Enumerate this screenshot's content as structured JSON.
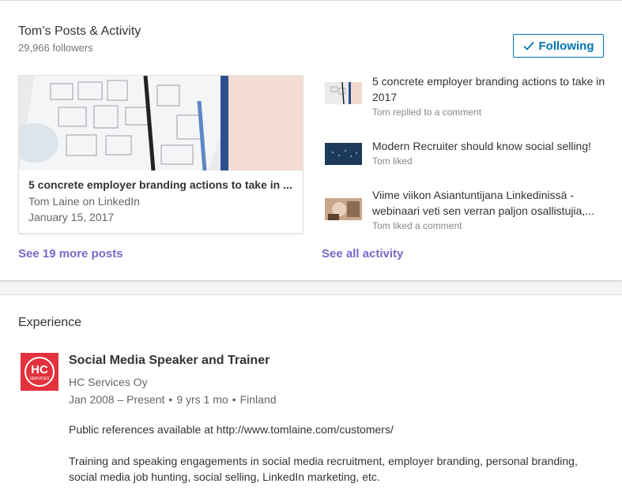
{
  "posts_section": {
    "title": "Tom’s Posts & Activity",
    "followers": "29,966 followers",
    "follow_button": "Following",
    "featured_post": {
      "title": "5 concrete employer branding actions to take in ...",
      "author": "Tom Laine on LinkedIn",
      "date": "January 15, 2017"
    },
    "activity": [
      {
        "title": "5 concrete employer branding actions to take in 2017",
        "meta": "Tom replied to a comment"
      },
      {
        "title": "Modern Recruiter should know social selling!",
        "meta": "Tom liked"
      },
      {
        "title": "Viime viikon Asiantuntijana Linkedinissä - webinaari veti sen verran paljon osallistujia,...",
        "meta": "Tom liked a comment"
      }
    ],
    "see_more_posts": "See 19 more posts",
    "see_all_activity": "See all activity"
  },
  "experience_section": {
    "title": "Experience",
    "job": {
      "title": "Social Media Speaker and Trainer",
      "company": "HC Services Oy",
      "date_range": "Jan 2008 – Present",
      "duration": "9 yrs 1 mo",
      "location": "Finland",
      "description_1": "Public references available at http://www.tomlaine.com/customers/",
      "description_2": "Training and speaking engagements in social media recruitment, employer branding, personal branding, social media job hunting, social selling, LinkedIn marketing, etc.",
      "logo_text": "HC",
      "logo_subtext": "SERVICES"
    }
  },
  "icons": {
    "follow": "checkmark-icon"
  },
  "colors": {
    "accent": "#0073b1",
    "link": "#7b68c9",
    "logo_red": "#e3323d"
  }
}
